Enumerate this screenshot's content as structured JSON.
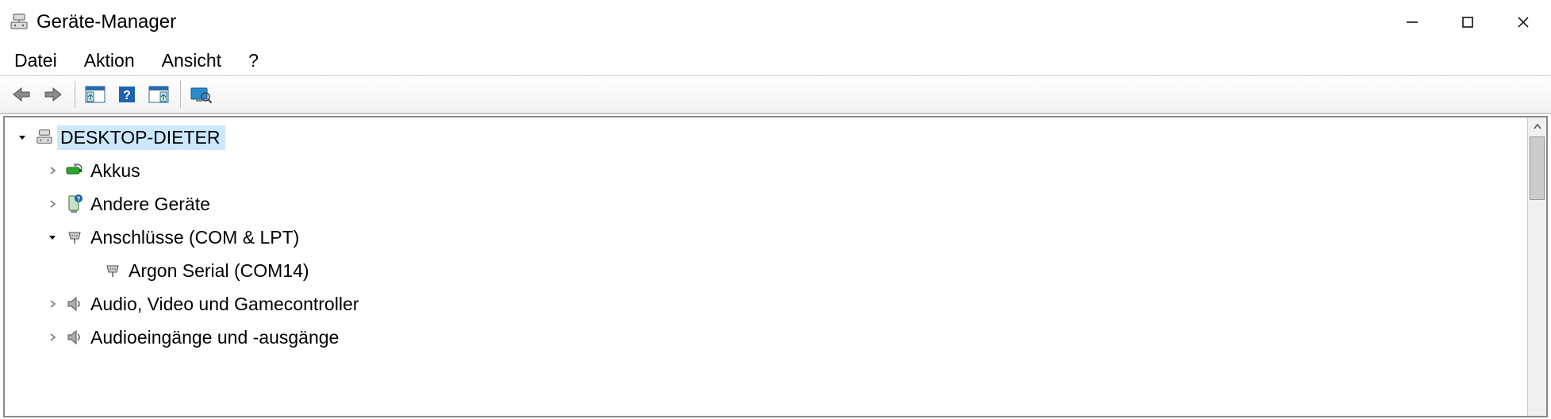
{
  "titlebar": {
    "title": "Geräte-Manager"
  },
  "menus": {
    "file": "Datei",
    "action": "Aktion",
    "view": "Ansicht",
    "help": "?"
  },
  "tree": {
    "root": "DESKTOP-DIETER",
    "batteries": "Akkus",
    "other_devices": "Andere Geräte",
    "ports": "Anschlüsse (COM & LPT)",
    "port_argon": "Argon Serial (COM14)",
    "audio_video_game": "Audio, Video und Gamecontroller",
    "audio_io": "Audioeingänge und -ausgänge"
  }
}
